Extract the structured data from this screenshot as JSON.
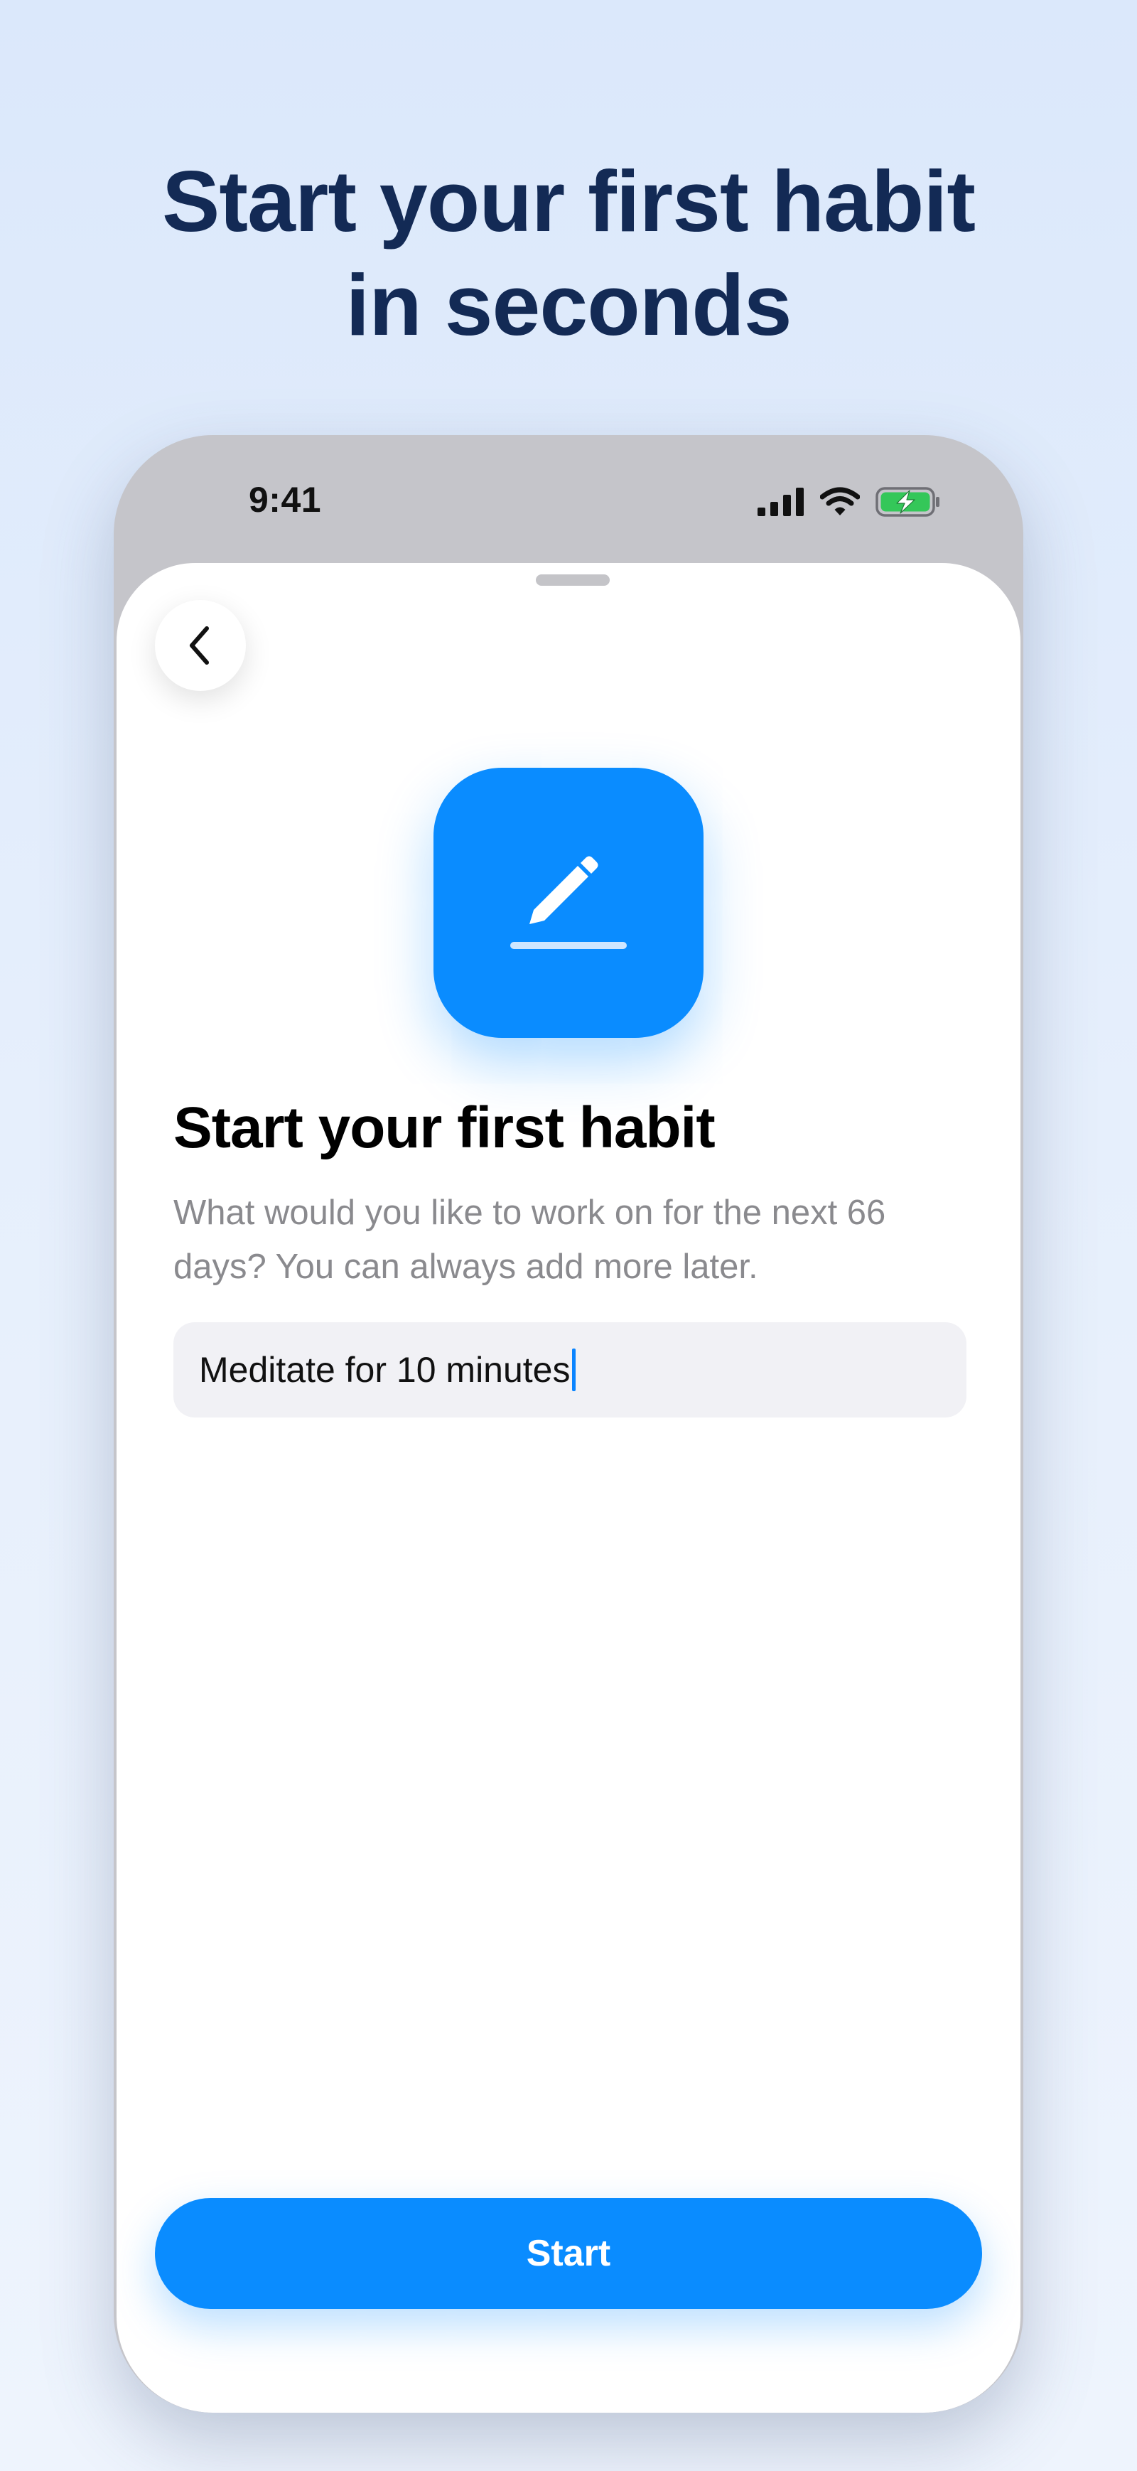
{
  "promo": {
    "headline_line1": "Start your first habit",
    "headline_line2": "in seconds"
  },
  "status_bar": {
    "time": "9:41",
    "icons": [
      "cellular-signal-icon",
      "wifi-icon",
      "battery-charging-icon"
    ]
  },
  "screen": {
    "back_icon": "chevron-left-icon",
    "app_icon": "pencil-icon",
    "title": "Start your first habit",
    "subtitle": "What would you like to work on for the next 66 days? You can always add more later.",
    "habit_input": {
      "value": "Meditate for 10 minutes"
    },
    "start_label": "Start"
  },
  "colors": {
    "accent": "#0a8cff",
    "headline": "#132a55",
    "battery": "#34c759",
    "background": "#dbe8fb"
  }
}
